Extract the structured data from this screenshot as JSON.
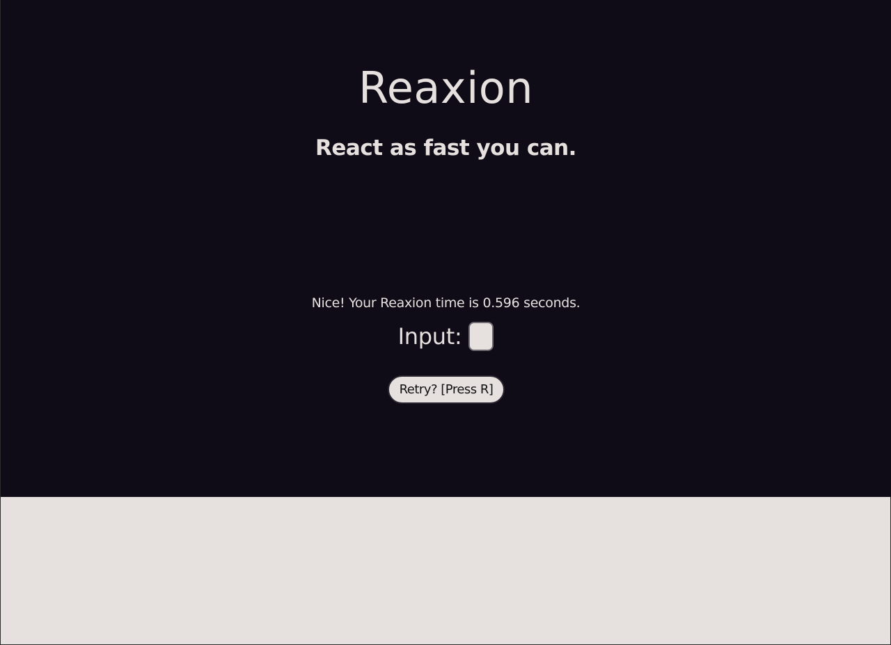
{
  "header": {
    "title": "Reaxion",
    "subtitle": "React as fast you can."
  },
  "result": {
    "message": "Nice! Your Reaxion time is 0.596 seconds."
  },
  "input": {
    "label": "Input:",
    "value": ""
  },
  "retry": {
    "label": "Retry? [Press R]"
  },
  "colors": {
    "panel_background": "#0f0c18",
    "page_background": "#e6e0df",
    "text": "#e6e0df"
  }
}
